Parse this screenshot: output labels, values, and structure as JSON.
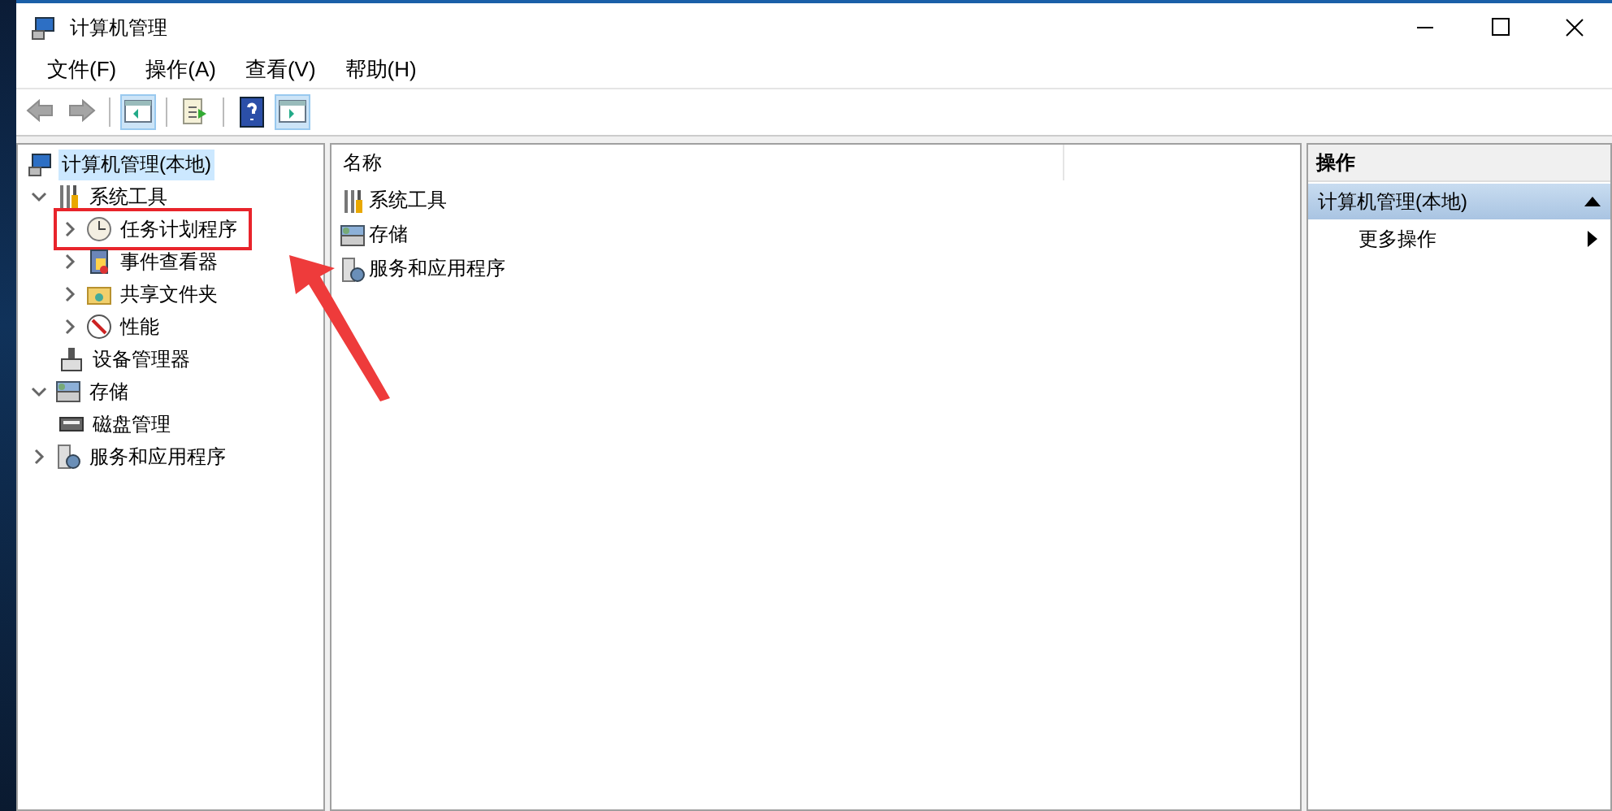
{
  "window": {
    "title": "计算机管理"
  },
  "menu": [
    "文件(F)",
    "操作(A)",
    "查看(V)",
    "帮助(H)"
  ],
  "toolbar": [
    {
      "kind": "back",
      "disabled": true
    },
    {
      "kind": "forward",
      "disabled": true
    },
    {
      "kind": "separator"
    },
    {
      "kind": "tree-pane",
      "on": true
    },
    {
      "kind": "separator"
    },
    {
      "kind": "export",
      "on": false
    },
    {
      "kind": "separator"
    },
    {
      "kind": "help",
      "on": false
    },
    {
      "kind": "action-pane",
      "on": true
    }
  ],
  "tree": [
    {
      "label": "计算机管理(本地)",
      "kind": "computer",
      "selected": true,
      "children": [
        {
          "label": "系统工具",
          "kind": "tools",
          "expanded": true,
          "selected": false,
          "children": [
            {
              "label": "任务计划程序",
              "kind": "clock",
              "expanded": false,
              "selected": false,
              "marked": true
            },
            {
              "label": "事件查看器",
              "kind": "log",
              "expanded": false,
              "selected": false
            },
            {
              "label": "共享文件夹",
              "kind": "folder",
              "expanded": false,
              "selected": false
            },
            {
              "label": "性能",
              "kind": "gauge",
              "expanded": false,
              "selected": false
            },
            {
              "label": "设备管理器",
              "kind": "device",
              "selected": false
            }
          ]
        },
        {
          "label": "存储",
          "kind": "storage",
          "expanded": true,
          "selected": false,
          "children": [
            {
              "label": "磁盘管理",
              "kind": "disk",
              "selected": false
            }
          ]
        },
        {
          "label": "服务和应用程序",
          "kind": "services",
          "expanded": false,
          "selected": false
        }
      ]
    }
  ],
  "list": {
    "columns": [
      "名称"
    ],
    "rows": [
      {
        "label": "系统工具",
        "kind": "tools"
      },
      {
        "label": "存储",
        "kind": "storage"
      },
      {
        "label": "服务和应用程序",
        "kind": "services"
      }
    ]
  },
  "actions": {
    "title": "操作",
    "sections": [
      {
        "title": "计算机管理(本地)",
        "expanded": true,
        "items": [
          {
            "label": "更多操作",
            "submenu": true
          }
        ]
      }
    ]
  }
}
